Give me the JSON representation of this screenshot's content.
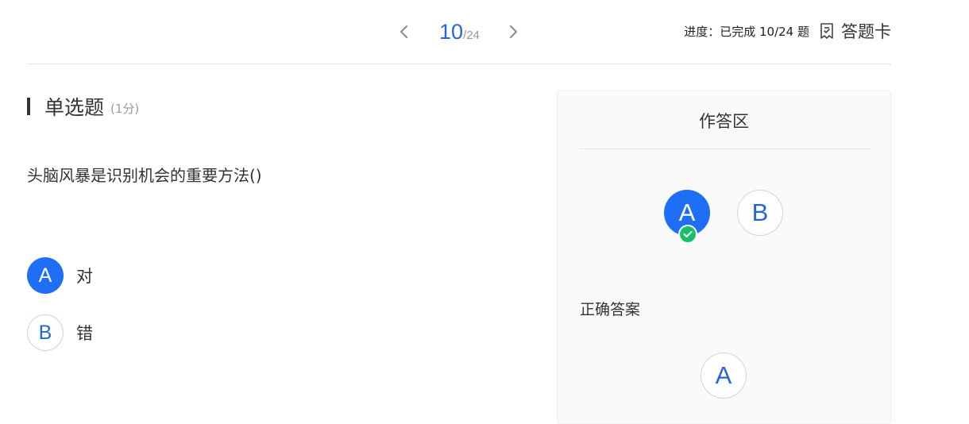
{
  "navigation": {
    "current": "10",
    "total": "/24",
    "prev_icon": "chevron-left-icon",
    "next_icon": "chevron-right-icon"
  },
  "progress": {
    "text": "进度：已完成 10/24 题",
    "answer_card_label": "答题卡",
    "answer_card_icon": "answer-sheet-icon"
  },
  "question": {
    "type_label": "单选题",
    "score": "(1分)",
    "text": "头脑风暴是识别机会的重要方法()",
    "options": [
      {
        "letter": "A",
        "text": "对",
        "selected": true
      },
      {
        "letter": "B",
        "text": "错",
        "selected": false
      }
    ]
  },
  "answer_area": {
    "title": "作答区",
    "choices": [
      {
        "letter": "A",
        "selected": true
      },
      {
        "letter": "B",
        "selected": false
      }
    ],
    "correct_label": "正确答案",
    "correct_answer": "A"
  },
  "colors": {
    "accent": "#1e6ff6",
    "accent_text": "#2565d9",
    "success": "#19be6b",
    "muted": "#999999"
  }
}
